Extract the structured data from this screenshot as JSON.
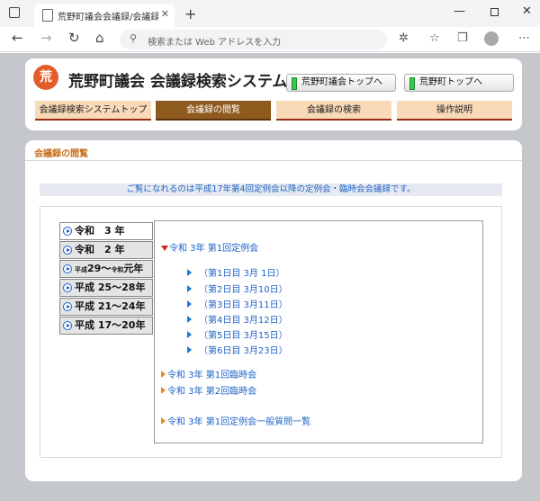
{
  "browser": {
    "tab_title": "荒野町議会会議録/会議録検索シス",
    "tab_close": "✕",
    "new_tab": "+",
    "address_placeholder": "検索または Web アドレスを入力"
  },
  "site": {
    "logo_text": "荒",
    "title": "荒野町議会 会議録検索システム",
    "top_buttons": [
      "荒野町議会トップへ",
      "荒野町トップへ"
    ],
    "nav_tabs": [
      "会議録検索システムトップ",
      "会議録の閲覧",
      "会議録の検索",
      "操作説明"
    ],
    "active_tab": "会議録の閲覧"
  },
  "section": {
    "title": "会議録の閲覧",
    "notice": "ご覧になれるのは平成17年第4回定例会以降の定例会・臨時会会議録です。"
  },
  "years": {
    "y0": "令和　3 年",
    "y1": "令和　2 年",
    "y2_a": "平成",
    "y2_b": "29～",
    "y2_c": "令和",
    "y2_d": "元年",
    "y3": "平成 25～28年",
    "y4": "平成 21～24年",
    "y5": "平成 17～20年"
  },
  "meetings": {
    "regular": "令和 3年 第1回定例会",
    "days": [
      "（第1日目 3月 1日）",
      "（第2日目 3月10日）",
      "（第3日目 3月11日）",
      "（第4日目 3月12日）",
      "（第5日目 3月15日）",
      "（第6日目 3月23日）"
    ],
    "extra1": "令和 3年 第1回臨時会",
    "extra2": "令和 3年 第2回臨時会",
    "questions": "令和 3年 第1回定例会一般質問一覧"
  },
  "colors": {
    "accent_orange": "#e88a1a",
    "link_blue": "#1e63c8",
    "active_tab": "#8f5a1e"
  }
}
